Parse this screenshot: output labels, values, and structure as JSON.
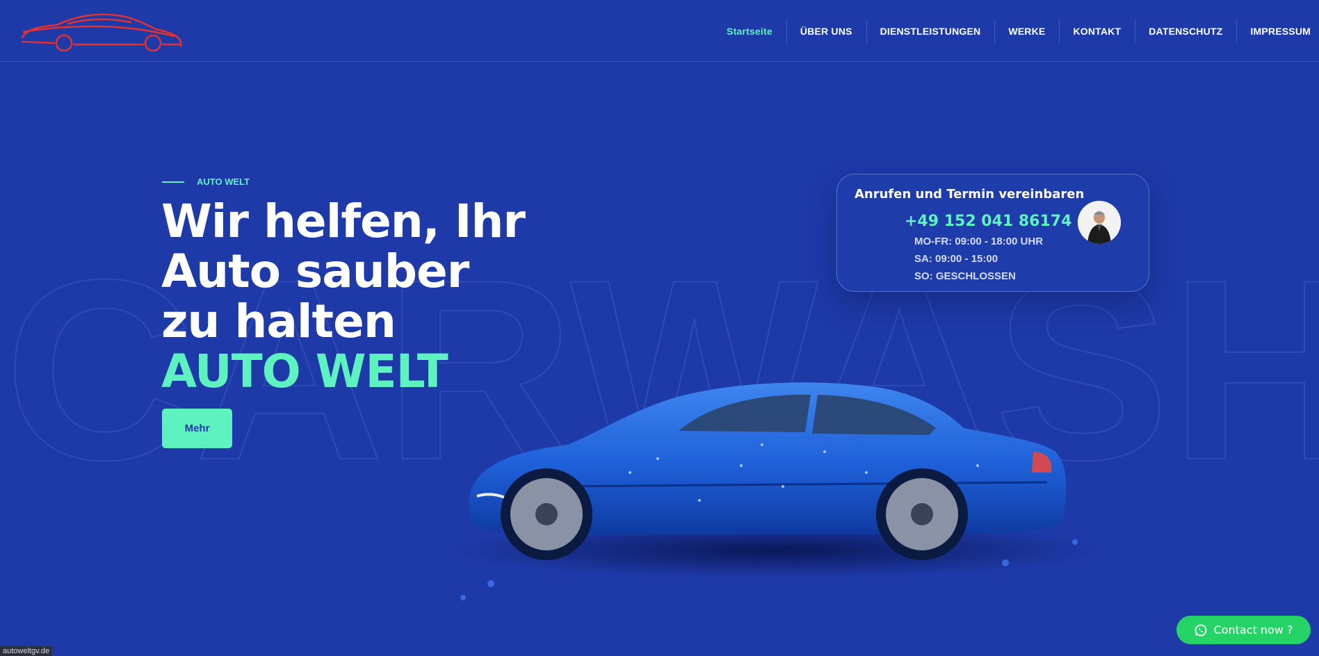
{
  "colors": {
    "background": "#1e3aa8",
    "accent": "#5ef2c0",
    "logo": "#e53030",
    "whatsapp": "#25d366"
  },
  "logo": {
    "icon": "car-silhouette-logo"
  },
  "nav": {
    "items": [
      {
        "label": "Startseite",
        "active": true
      },
      {
        "label": "ÜBER UNS"
      },
      {
        "label": "DIENSTLEISTUNGEN"
      },
      {
        "label": "WERKE"
      },
      {
        "label": "KONTAKT"
      },
      {
        "label": "DATENSCHUTZ"
      },
      {
        "label": "IMPRESSUM"
      }
    ]
  },
  "watermark": {
    "text": "CARWASH"
  },
  "hero": {
    "eyebrow": "AUTO WELT",
    "title_line1": "Wir helfen, Ihr",
    "title_line2": "Auto sauber",
    "title_line3": "zu halten",
    "title_accent": "AUTO WELT",
    "button": "Mehr"
  },
  "contact_card": {
    "title": "Anrufen und Termin vereinbaren",
    "phone": "+49 152 041 86174",
    "hours": [
      "MO-FR: 09:00 - 18:00 UHR",
      "SA: 09:00 - 15:00",
      "SO: GESCHLOSSEN"
    ]
  },
  "whatsapp": {
    "label": "Contact now ?",
    "icon": "whatsapp-icon"
  },
  "status": {
    "url": "autoweltgv.de"
  }
}
